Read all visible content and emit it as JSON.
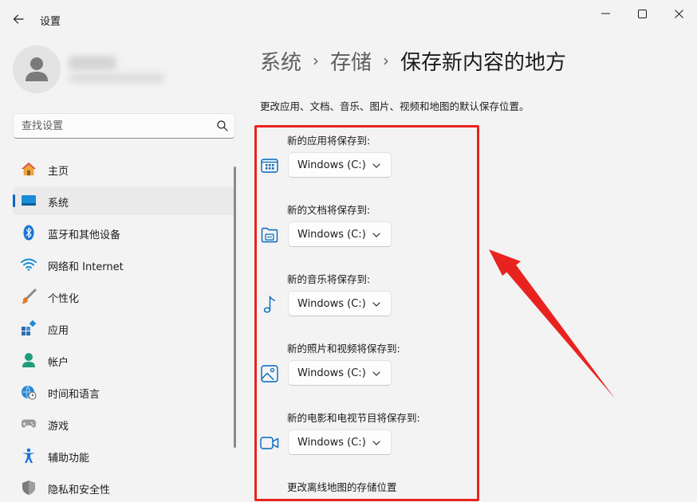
{
  "window": {
    "title": "设置",
    "controls": {
      "minimize": "minimize-icon",
      "maximize": "maximize-icon",
      "close": "close-icon"
    }
  },
  "search": {
    "placeholder": "查找设置"
  },
  "nav": {
    "items": [
      {
        "label": "主页",
        "icon": "home-icon"
      },
      {
        "label": "系统",
        "icon": "system-icon",
        "selected": true
      },
      {
        "label": "蓝牙和其他设备",
        "icon": "bluetooth-icon"
      },
      {
        "label": "网络和 Internet",
        "icon": "wifi-icon"
      },
      {
        "label": "个性化",
        "icon": "brush-icon"
      },
      {
        "label": "应用",
        "icon": "apps-icon"
      },
      {
        "label": "帐户",
        "icon": "account-icon"
      },
      {
        "label": "时间和语言",
        "icon": "globe-clock-icon"
      },
      {
        "label": "游戏",
        "icon": "gamepad-icon"
      },
      {
        "label": "辅助功能",
        "icon": "accessibility-icon"
      },
      {
        "label": "隐私和安全性",
        "icon": "shield-icon"
      }
    ]
  },
  "breadcrumb": {
    "items": [
      "系统",
      "存储",
      "保存新内容的地方"
    ],
    "separator": "›"
  },
  "description": "更改应用、文档、音乐、图片、视频和地图的默认保存位置。",
  "sections": [
    {
      "label": "新的应用将保存到:",
      "value": "Windows (C:)",
      "icon": "apps-window-icon"
    },
    {
      "label": "新的文档将保存到:",
      "value": "Windows (C:)",
      "icon": "folder-document-icon"
    },
    {
      "label": "新的音乐将保存到:",
      "value": "Windows (C:)",
      "icon": "music-note-icon"
    },
    {
      "label": "新的照片和视频将保存到:",
      "value": "Windows (C:)",
      "icon": "photo-icon"
    },
    {
      "label": "新的电影和电视节目将保存到:",
      "value": "Windows (C:)",
      "icon": "video-camera-icon"
    }
  ],
  "offline_maps_label": "更改离线地图的存储位置",
  "colors": {
    "accent": "#0067c0",
    "annotation_red": "#e8231f",
    "background": "#f3f3f3"
  }
}
